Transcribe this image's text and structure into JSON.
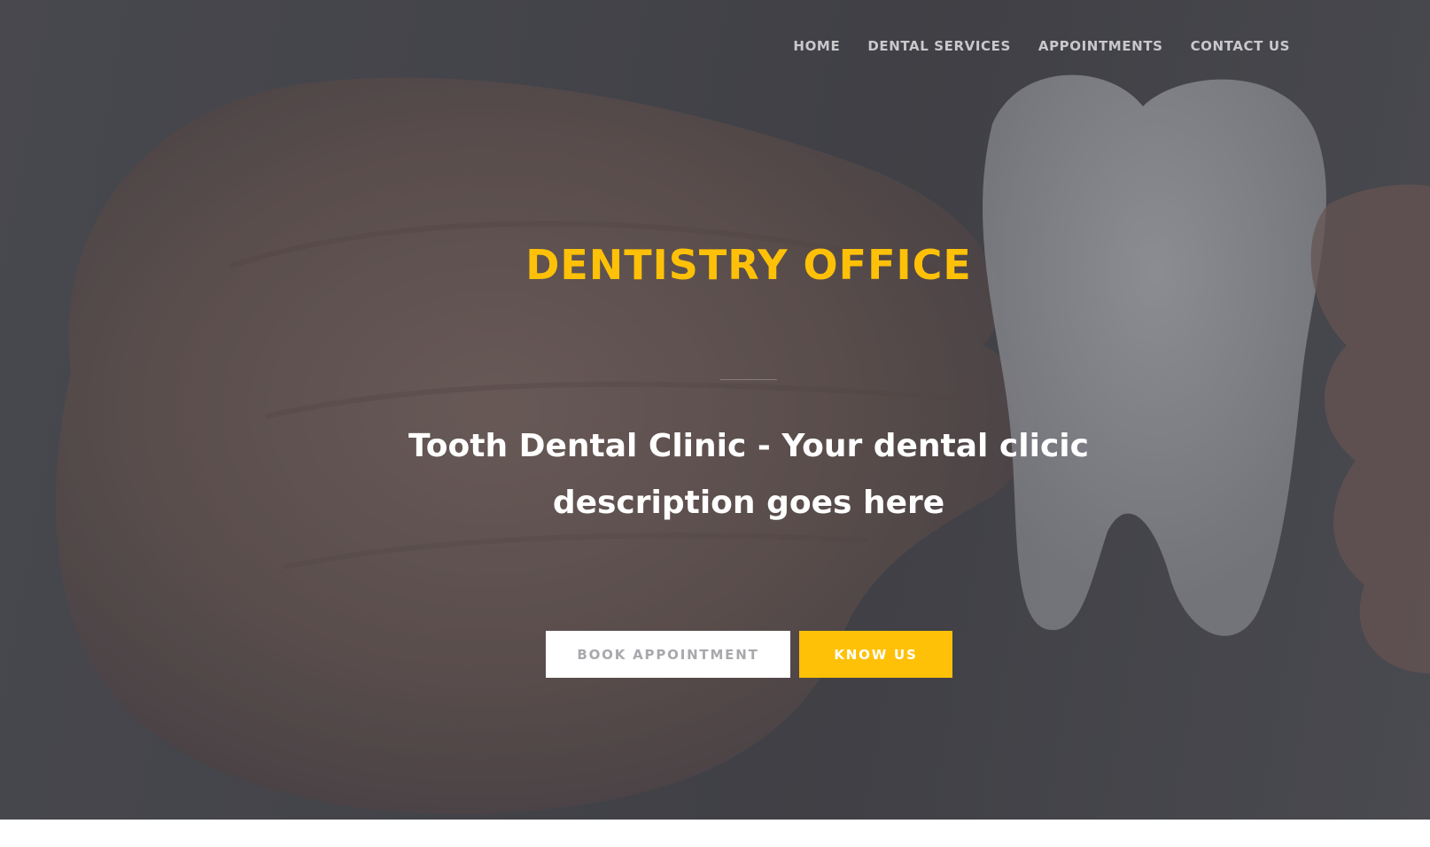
{
  "nav": {
    "items": [
      {
        "label": "HOME"
      },
      {
        "label": "DENTAL SERVICES"
      },
      {
        "label": "APPOINTMENTS"
      },
      {
        "label": "CONTACT US"
      }
    ]
  },
  "hero": {
    "title": "DENTISTRY OFFICE",
    "subtitle": "Tooth Dental Clinic - Your dental clicic description goes here",
    "buttons": {
      "book_label": "BOOK APPOINTMENT",
      "know_label": "KNOW US"
    }
  },
  "colors": {
    "accent": "#ffc107",
    "overlay": "#3a3a40",
    "text_light": "#ffffff"
  }
}
